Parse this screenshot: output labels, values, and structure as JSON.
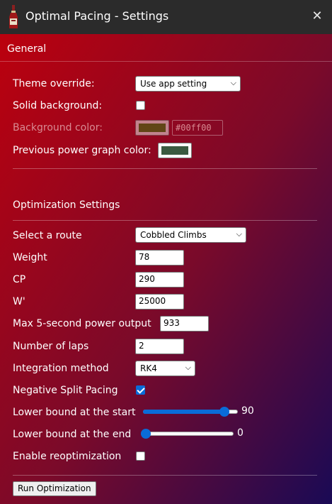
{
  "window": {
    "title": "Optimal Pacing - Settings",
    "close_glyph": "✕",
    "app_icon": "wine-bottle-icon"
  },
  "general": {
    "heading": "General",
    "theme_override": {
      "label": "Theme override:",
      "value": "Use app setting"
    },
    "solid_background": {
      "label": "Solid background:",
      "checked": false
    },
    "background_color": {
      "label": "Background color:",
      "swatch_color": "#00ff00",
      "hex_value": "#00ff00",
      "disabled": true
    },
    "prev_power_color": {
      "label": "Previous power graph color:",
      "swatch_color": "#3a5a40"
    }
  },
  "optimization": {
    "heading": "Optimization Settings",
    "route": {
      "label": "Select a route",
      "value": "Cobbled Climbs"
    },
    "weight": {
      "label": "Weight",
      "value": "78"
    },
    "cp": {
      "label": "CP",
      "value": "290"
    },
    "w_prime": {
      "label": "W'",
      "value": "25000"
    },
    "max_5s_power": {
      "label": "Max 5-second power output",
      "value": "933"
    },
    "laps": {
      "label": "Number of laps",
      "value": "2"
    },
    "integration": {
      "label": "Integration method",
      "value": "RK4"
    },
    "negative_split": {
      "label": "Negative Split Pacing",
      "checked": true
    },
    "lower_bound_start": {
      "label": "Lower bound at the start",
      "value": "90",
      "fraction": 0.9
    },
    "lower_bound_end": {
      "label": "Lower bound at the end",
      "value": "0",
      "fraction": 0.0
    },
    "reoptimization": {
      "label": "Enable reoptimization",
      "checked": false
    },
    "run_button": "Run Optimization"
  },
  "colors": {
    "accent": "#0a6cd8",
    "titlebar": "#2b2b2b",
    "gradient_start": "#c0000c",
    "gradient_end": "#1a0a55"
  }
}
